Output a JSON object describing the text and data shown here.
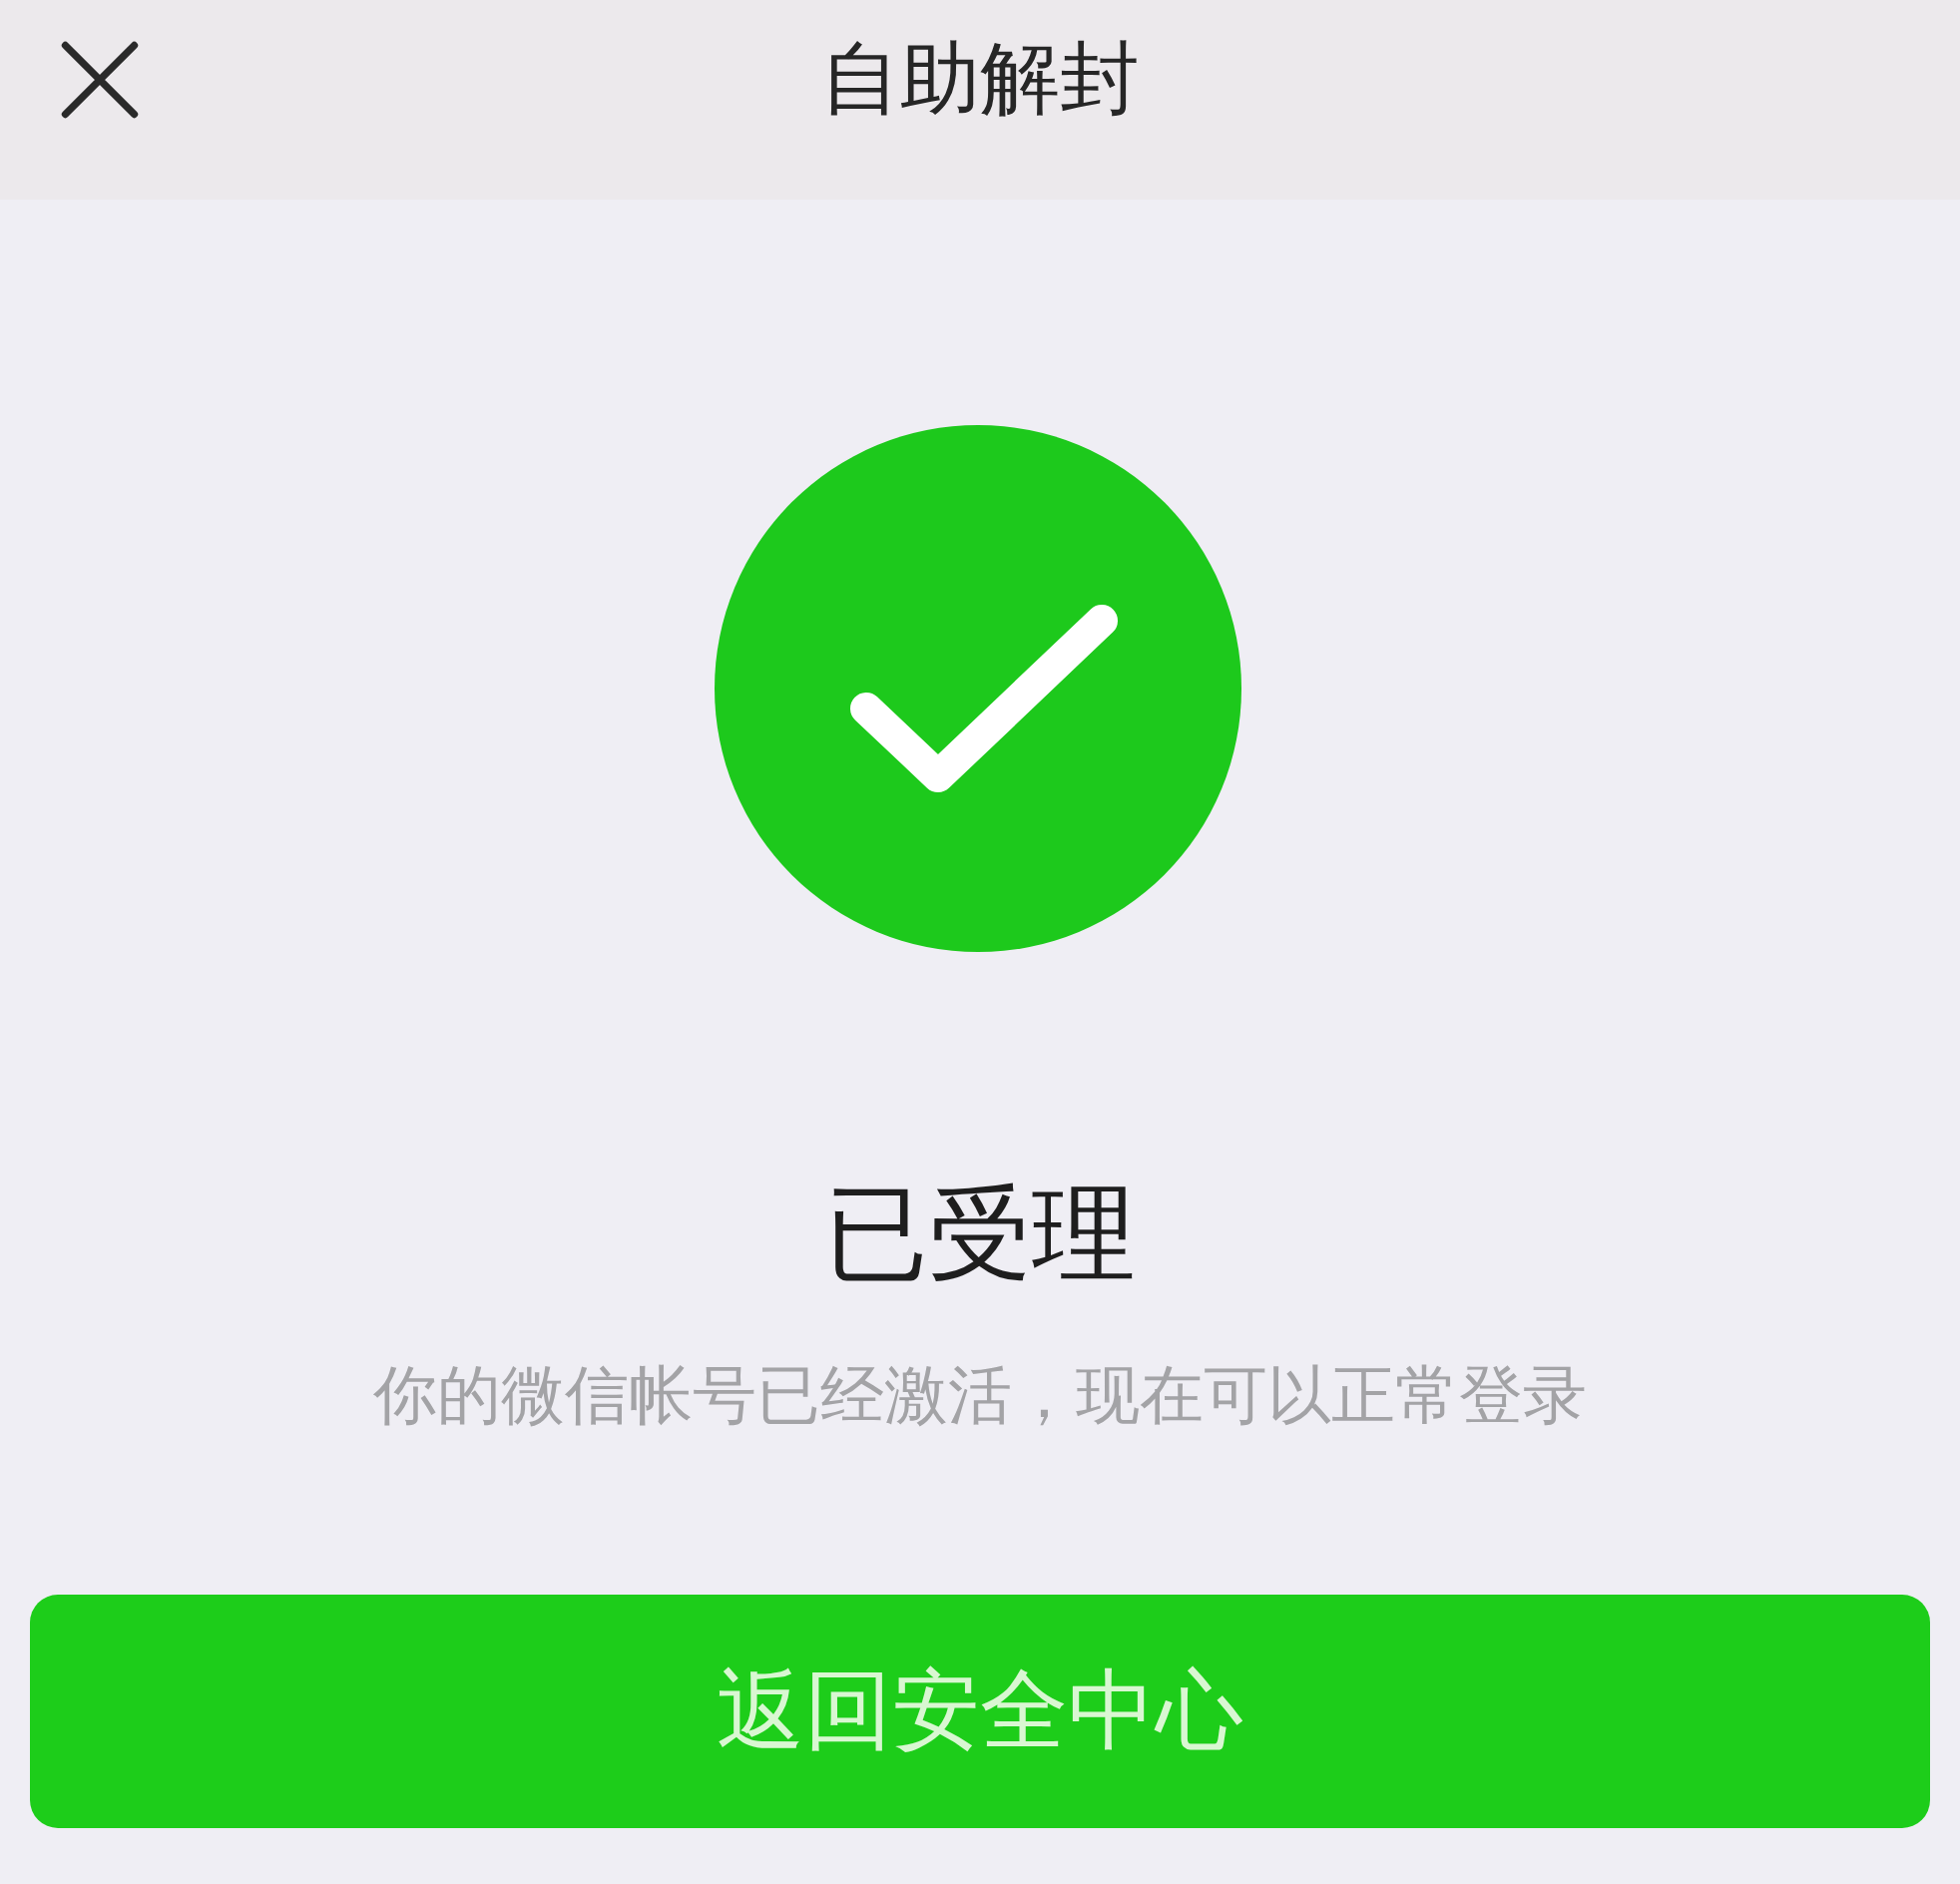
{
  "header": {
    "title": "自助解封",
    "close_button": true
  },
  "result": {
    "kind": "success",
    "title": "已受理",
    "message": "你的微信帐号已经激活，现在可以正常登录"
  },
  "primary_button": {
    "label": "返回安全中心"
  }
}
